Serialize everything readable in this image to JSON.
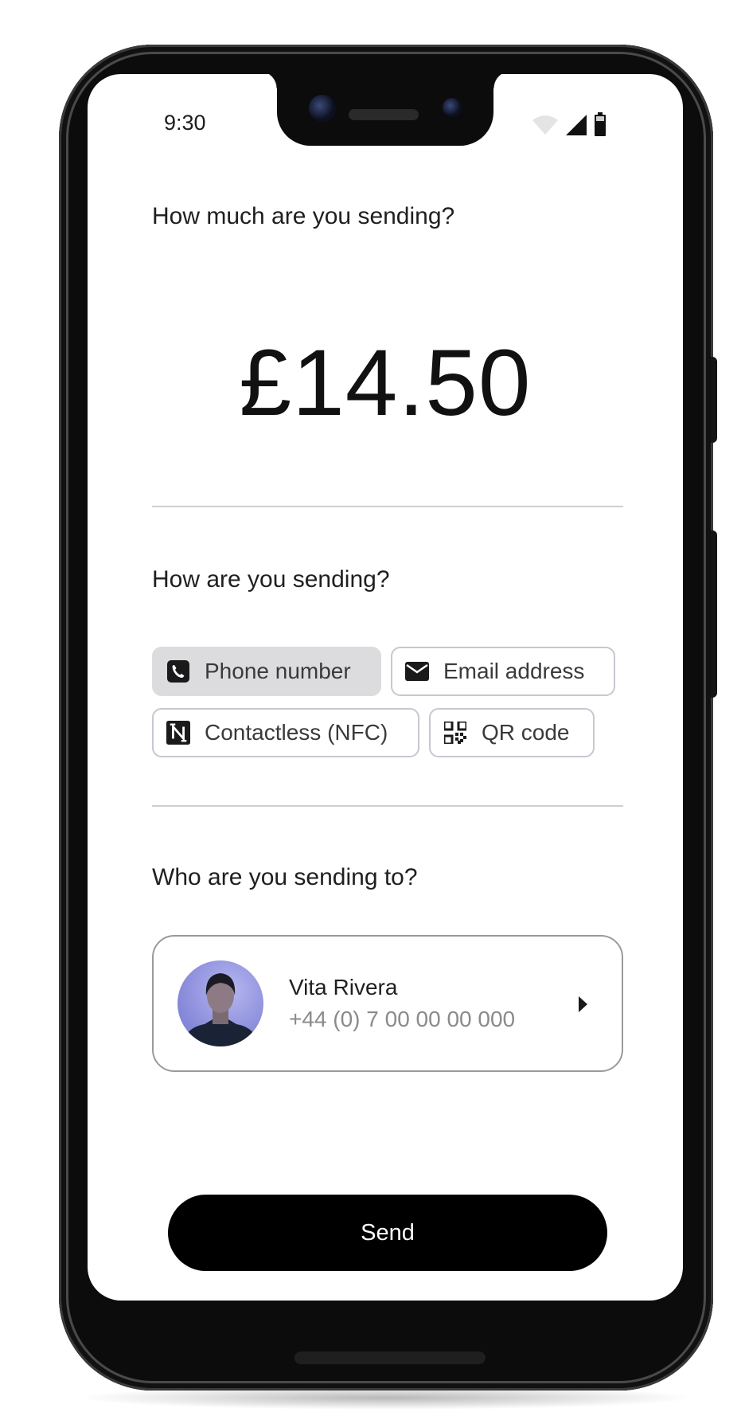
{
  "status_bar": {
    "time": "9:30"
  },
  "amount_section": {
    "question": "How much are you sending?",
    "amount": "£14.50"
  },
  "method_section": {
    "question": "How are you sending?",
    "options": [
      {
        "label": "Phone number",
        "icon": "phone-icon",
        "selected": true
      },
      {
        "label": "Email address",
        "icon": "mail-icon",
        "selected": false
      },
      {
        "label": "Contactless (NFC)",
        "icon": "nfc-icon",
        "selected": false
      },
      {
        "label": "QR code",
        "icon": "qr-code-icon",
        "selected": false
      }
    ]
  },
  "recipient_section": {
    "question": "Who are you sending to?",
    "recipient": {
      "name": "Vita Rivera",
      "phone": "+44 (0) 7 00 00 00 000"
    }
  },
  "send_button": {
    "label": "Send"
  }
}
